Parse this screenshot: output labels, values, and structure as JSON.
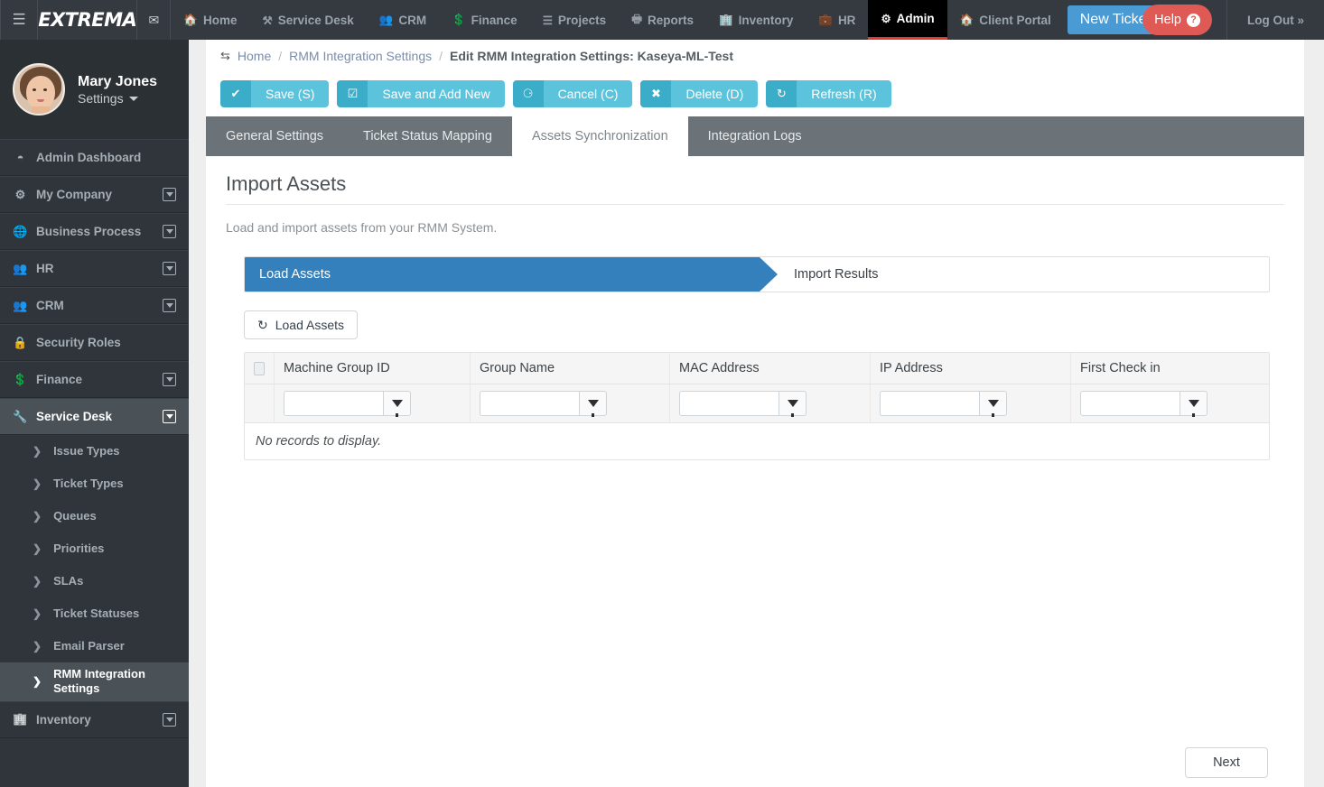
{
  "topnav": {
    "hamburger_icon": "hamburger-icon",
    "logo": "EXTREMA",
    "mail_icon": "envelope-icon",
    "items": [
      {
        "label": "Home",
        "icon": "home-icon",
        "active": false
      },
      {
        "label": "Service Desk",
        "icon": "wrench-icon",
        "active": false
      },
      {
        "label": "CRM",
        "icon": "users-icon",
        "active": false
      },
      {
        "label": "Finance",
        "icon": "money-icon",
        "active": false
      },
      {
        "label": "Projects",
        "icon": "tasks-icon",
        "active": false
      },
      {
        "label": "Reports",
        "icon": "print-icon",
        "active": false
      },
      {
        "label": "Inventory",
        "icon": "building-icon",
        "active": false
      },
      {
        "label": "HR",
        "icon": "briefcase-icon",
        "active": false
      },
      {
        "label": "Admin",
        "icon": "gear-icon",
        "active": true
      },
      {
        "label": "Client Portal",
        "icon": "home-icon",
        "active": false
      }
    ],
    "new_ticket": "New Ticket",
    "help": "Help",
    "help_badge": "?",
    "logout": "Log Out »"
  },
  "sidebar": {
    "user_name": "Mary Jones",
    "settings_label": "Settings",
    "items": [
      {
        "label": "Admin Dashboard",
        "icon": "dashboard-icon",
        "expandable": false,
        "active": false
      },
      {
        "label": "My Company",
        "icon": "gear-icon",
        "expandable": true,
        "active": false
      },
      {
        "label": "Business Process",
        "icon": "globe-icon",
        "expandable": true,
        "active": false
      },
      {
        "label": "HR",
        "icon": "users-icon",
        "expandable": true,
        "active": false
      },
      {
        "label": "CRM",
        "icon": "users-icon",
        "expandable": true,
        "active": false
      },
      {
        "label": "Security Roles",
        "icon": "lock-icon",
        "expandable": false,
        "active": false
      },
      {
        "label": "Finance",
        "icon": "money-icon",
        "expandable": true,
        "active": false
      },
      {
        "label": "Service Desk",
        "icon": "wrench-icon",
        "expandable": true,
        "active": true
      }
    ],
    "sub_items": [
      {
        "label": "Issue Types",
        "active": false
      },
      {
        "label": "Ticket Types",
        "active": false
      },
      {
        "label": "Queues",
        "active": false
      },
      {
        "label": "Priorities",
        "active": false
      },
      {
        "label": "SLAs",
        "active": false
      },
      {
        "label": "Ticket Statuses",
        "active": false
      },
      {
        "label": "Email Parser",
        "active": false
      },
      {
        "label": "RMM Integration Settings",
        "active": true
      }
    ],
    "tail_items": [
      {
        "label": "Inventory",
        "icon": "building-icon",
        "expandable": true,
        "active": false
      }
    ]
  },
  "breadcrumb": {
    "icon": "exchange-icon",
    "home": "Home",
    "sep": "/",
    "parent": "RMM Integration Settings",
    "current": "Edit RMM Integration Settings: Kaseya-ML-Test"
  },
  "toolbar": {
    "buttons": [
      {
        "label": "Save (S)",
        "icon": "check-icon"
      },
      {
        "label": "Save and Add New",
        "icon": "check-square-icon"
      },
      {
        "label": "Cancel (C)",
        "icon": "minus-circle-icon"
      },
      {
        "label": "Delete (D)",
        "icon": "close-icon"
      },
      {
        "label": "Refresh (R)",
        "icon": "refresh-icon"
      }
    ]
  },
  "tabs": [
    {
      "label": "General Settings",
      "active": false
    },
    {
      "label": "Ticket Status Mapping",
      "active": false
    },
    {
      "label": "Assets Synchronization",
      "active": true
    },
    {
      "label": "Integration Logs",
      "active": false
    }
  ],
  "main": {
    "title": "Import Assets",
    "subtitle": "Load and import assets from your RMM System.",
    "wizard": {
      "step1": "Load Assets",
      "step2": "Import Results"
    },
    "load_button": {
      "label": "Load Assets",
      "icon": "refresh-icon"
    },
    "grid": {
      "columns": [
        "Machine Group ID",
        "Group Name",
        "MAC Address",
        "IP Address",
        "First Check in"
      ],
      "filter_values": [
        "",
        "",
        "",
        "",
        ""
      ],
      "filter_icon": "funnel-icon",
      "rows": [],
      "empty_text": "No records to display."
    },
    "next_button": "Next"
  },
  "colors": {
    "nav_bg": "#343a40",
    "sidebar_bg": "#2f353a",
    "accent_teal": "#5bc4dc",
    "accent_teal_dark": "#3cadc9",
    "wizard_blue": "#3380bd",
    "new_ticket_blue": "#4a9ad4",
    "help_red": "#e05a55",
    "tabbar_gray": "#6b7378",
    "admin_underline": "#e03a32"
  }
}
